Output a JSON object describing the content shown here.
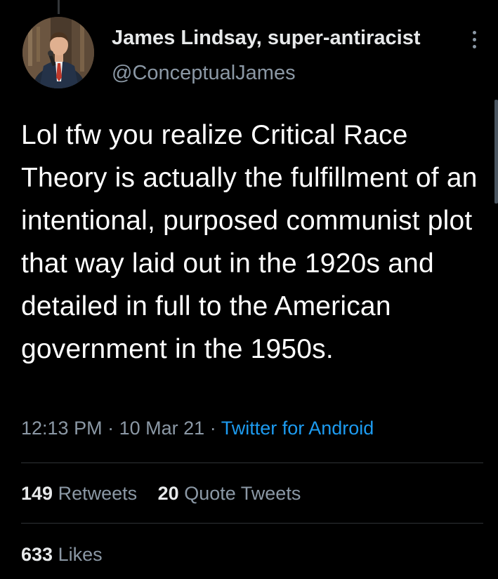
{
  "tweet": {
    "author": {
      "display_name": "James Lindsay, super-antiracist",
      "handle": "@ConceptualJames"
    },
    "text": "Lol tfw you realize Critical Race Theory is actually the fulfillment of an intentional, purposed communist plot that way laid out in the 1920s and detailed in full to the American government in the 1950s.",
    "time": "12:13 PM",
    "date": "10 Mar 21",
    "source": "Twitter for Android",
    "separator": "·",
    "retweets": {
      "count": "149",
      "label": "Retweets"
    },
    "quote_tweets": {
      "count": "20",
      "label": "Quote Tweets"
    },
    "likes": {
      "count": "633",
      "label": "Likes"
    }
  },
  "colors": {
    "background": "#000000",
    "primary_text": "#e7e9ea",
    "secondary_text": "#8b98a5",
    "link": "#1d9bf0",
    "divider": "#2f3336"
  },
  "icons": {
    "more_menu": "more-vertical-icon"
  }
}
